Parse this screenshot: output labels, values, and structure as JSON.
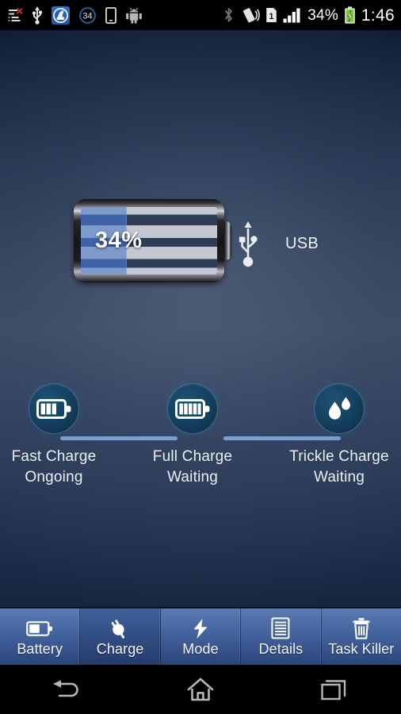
{
  "status_bar": {
    "left_icons": [
      {
        "name": "notifications-cleared-icon",
        "label": "list-x"
      },
      {
        "name": "usb-icon",
        "label": "USB"
      },
      {
        "name": "app-running-icon",
        "label": "Battery Doctor"
      },
      {
        "name": "battery-level-circle-icon",
        "label": "34"
      },
      {
        "name": "phone-icon",
        "label": "phone"
      },
      {
        "name": "android-icon",
        "label": "android"
      }
    ],
    "right_icons": [
      {
        "name": "bluetooth-icon",
        "label": "Bluetooth"
      },
      {
        "name": "vibrate-icon",
        "label": "Vibrate"
      },
      {
        "name": "sim-card-icon",
        "label": "SIM 1"
      },
      {
        "name": "signal-bars-icon",
        "label": "Signal"
      }
    ],
    "battery_percent": "34%",
    "battery_charging_icon": "battery-charging-icon",
    "clock": "1:46"
  },
  "battery": {
    "percent_label": "34%",
    "fill_percent": 34,
    "fill_color": "#4f73b4"
  },
  "source": {
    "icon": "usb-icon",
    "label": "USB"
  },
  "stages": [
    {
      "icon": "battery-half-icon",
      "name": "Fast Charge",
      "state": "Ongoing"
    },
    {
      "icon": "battery-full-icon",
      "name": "Full Charge",
      "state": "Waiting"
    },
    {
      "icon": "water-drops-icon",
      "name": "Trickle Charge",
      "state": "Waiting"
    }
  ],
  "stage_line_color": "#7e9ed0",
  "tabs": [
    {
      "label": "Battery",
      "icon": "battery-icon",
      "active": false
    },
    {
      "label": "Charge",
      "icon": "power-plug-icon",
      "active": true
    },
    {
      "label": "Mode",
      "icon": "lightning-bolt-icon",
      "active": false
    },
    {
      "label": "Details",
      "icon": "document-lines-icon",
      "active": false
    },
    {
      "label": "Task Killer",
      "icon": "trash-can-icon",
      "active": false
    }
  ],
  "nav_bar": [
    {
      "name": "back-button",
      "icon": "back-arrow-icon"
    },
    {
      "name": "home-button",
      "icon": "home-icon"
    },
    {
      "name": "recents-button",
      "icon": "recents-icon"
    }
  ]
}
